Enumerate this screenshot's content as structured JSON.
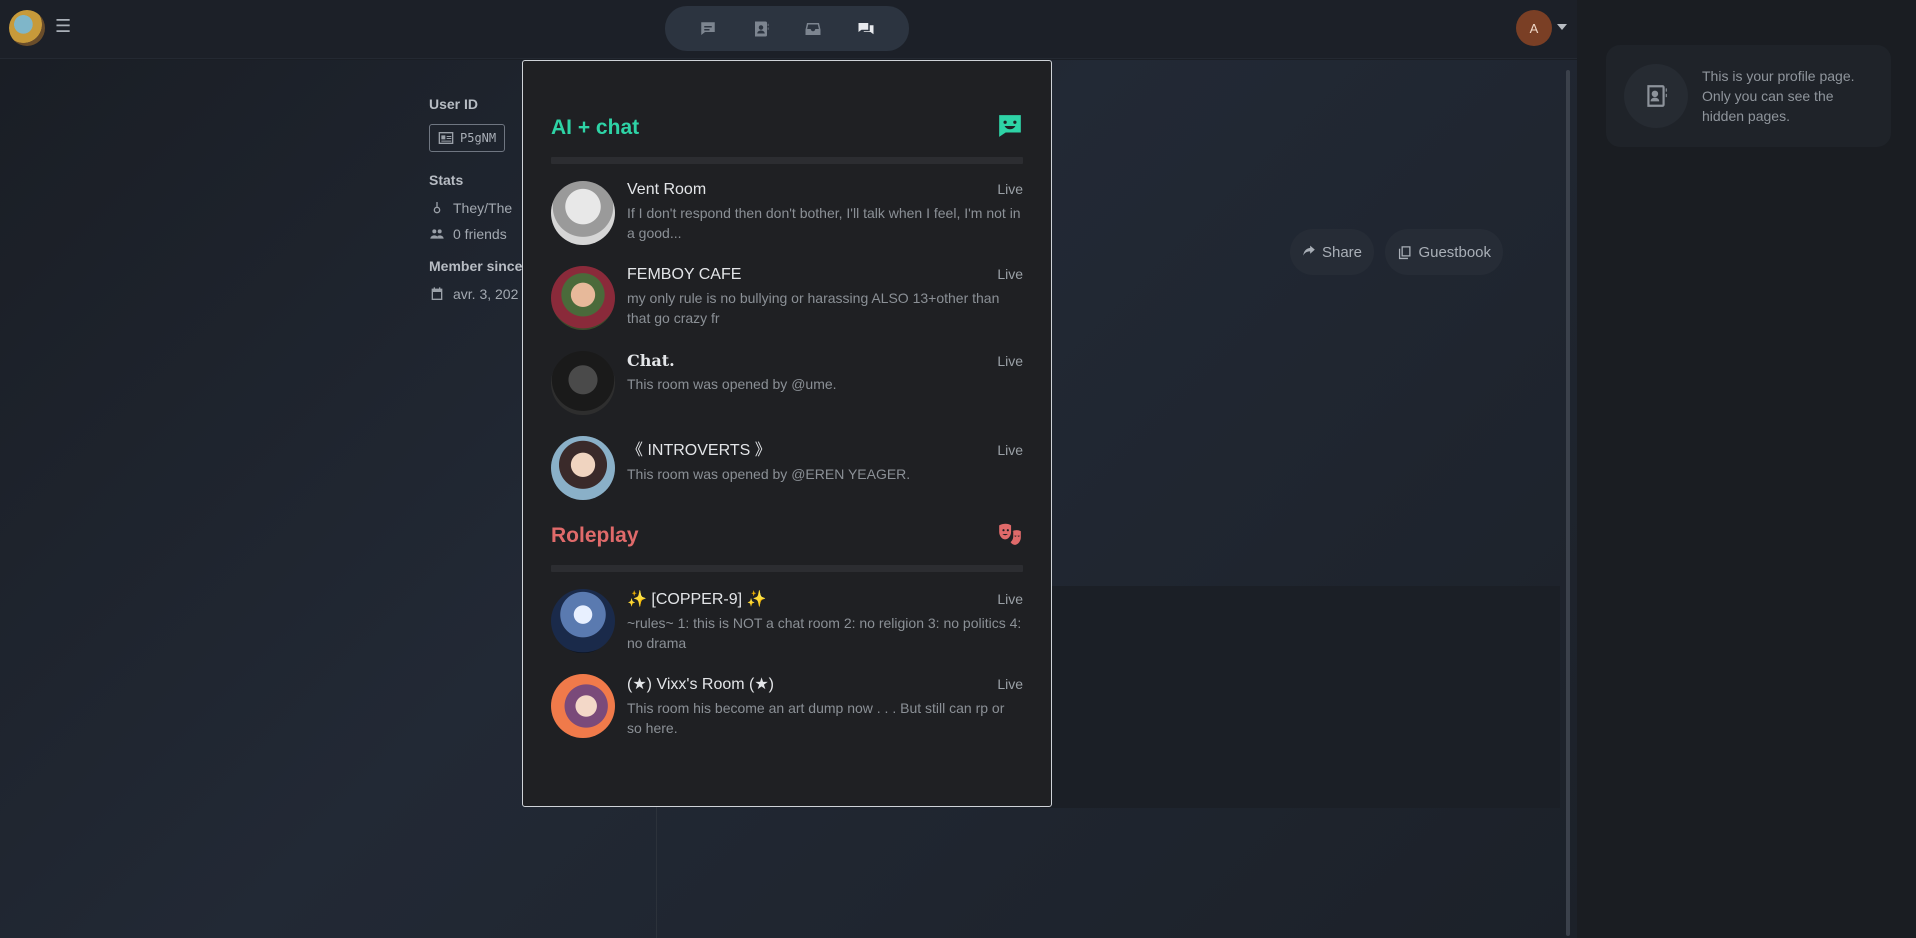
{
  "profile": {
    "user_id_label": "User ID",
    "user_id": "P5gNM",
    "stats_label": "Stats",
    "pronouns": "They/The",
    "friends": "0 friends",
    "member_since_label": "Member since",
    "member_since": "avr. 3, 202"
  },
  "topbar": {
    "user_initial": "A",
    "nav_icons": [
      "chat-bubble-icon",
      "contact-book-icon",
      "inbox-icon",
      "chats-icon"
    ]
  },
  "actions": {
    "share": "Share",
    "guestbook": "Guestbook"
  },
  "hint": {
    "text": "This is your profile page. Only you can see the hidden pages."
  },
  "popup": {
    "sections": [
      {
        "title": "AI + chat",
        "rooms": [
          {
            "name": "Vent Room",
            "status": "Live",
            "desc": "If I don't respond then don't bother, I'll talk when I feel, I'm not in a good..."
          },
          {
            "name": "FEMBOY CAFE",
            "status": "Live",
            "desc": "my only rule is no bullying or harassing ALSO 13+other than that go crazy fr"
          },
          {
            "name": "Chat.",
            "status": "Live",
            "desc": "This room was opened by @ume."
          },
          {
            "name": "《 INTROVERTS 》",
            "status": "Live",
            "desc": "This room was opened by @EREN YEAGER."
          }
        ]
      },
      {
        "title": "Roleplay",
        "rooms": [
          {
            "name": "✨ [COPPER-9] ✨",
            "status": "Live",
            "desc": "~rules~ 1: this is NOT a chat room 2: no religion 3: no politics 4: no drama"
          },
          {
            "name": "(★) Vixx's Room (★)",
            "status": "Live",
            "desc": "This room his become an art dump now . . . But still can rp or so here."
          }
        ]
      }
    ]
  },
  "colors": {
    "ai_accent": "#2ed3a6",
    "roleplay_accent": "#e06a6a"
  }
}
